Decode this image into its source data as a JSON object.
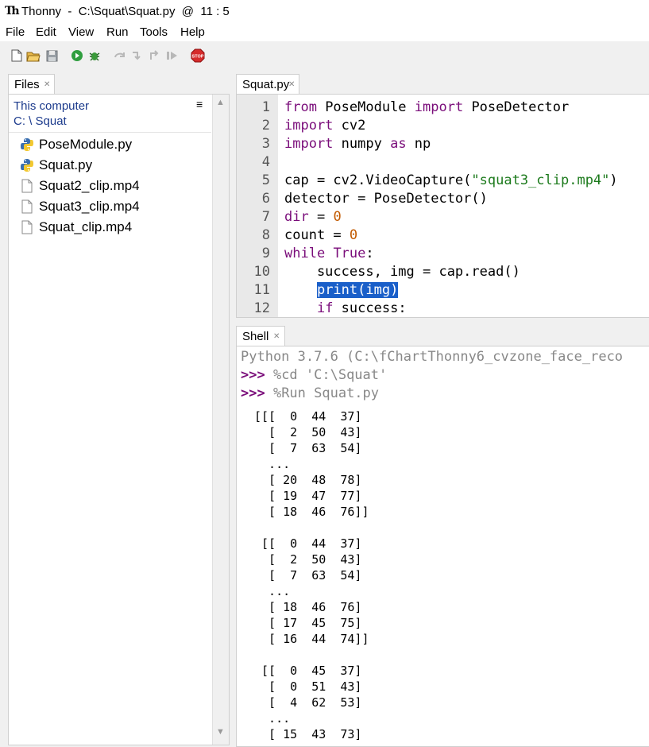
{
  "window": {
    "title": "Thonny  -  C:\\Squat\\Squat.py  @  11 : 5",
    "logo": "Th"
  },
  "menu": [
    "File",
    "Edit",
    "View",
    "Run",
    "Tools",
    "Help"
  ],
  "files_panel": {
    "tab_label": "Files",
    "location_line1": "This computer",
    "location_line2": "C: \\ Squat",
    "files": [
      {
        "name": "PoseModule.py",
        "icon": "python-file-icon"
      },
      {
        "name": "Squat.py",
        "icon": "python-file-icon"
      },
      {
        "name": "Squat2_clip.mp4",
        "icon": "file-icon"
      },
      {
        "name": "Squat3_clip.mp4",
        "icon": "file-icon"
      },
      {
        "name": "Squat_clip.mp4",
        "icon": "file-icon"
      }
    ]
  },
  "editor": {
    "tab_label": "Squat.py",
    "line_numbers": [
      "1",
      "2",
      "3",
      "4",
      "5",
      "6",
      "7",
      "8",
      "9",
      "10",
      "11",
      "12"
    ],
    "lines": {
      "l1": {
        "kw1": "from",
        "mid": " PoseModule ",
        "kw2": "import",
        "end": " PoseDetector"
      },
      "l2": {
        "kw": "import",
        "rest": " cv2"
      },
      "l3": {
        "kw1": "import",
        "mid": " numpy ",
        "kw2": "as",
        "end": " np"
      },
      "l5": {
        "pre": "cap = cv2.VideoCapture(",
        "str": "\"squat3_clip.mp4\"",
        "post": ")"
      },
      "l6": {
        "text": "detector = PoseDetector()"
      },
      "l7": {
        "kw": "dir",
        "mid": " = ",
        "num": "0"
      },
      "l8": {
        "pre": "count = ",
        "num": "0"
      },
      "l9": {
        "kw1": "while",
        "sp": " ",
        "kw2": "True",
        "post": ":"
      },
      "l10": {
        "text": "    success, img = cap.read()"
      },
      "l11": {
        "indent": "    ",
        "sel": "print(img)"
      },
      "l12": {
        "indent": "    ",
        "kw": "if",
        "rest": " success:"
      }
    }
  },
  "shell": {
    "tab_label": "Shell",
    "banner": "Python 3.7.6 (C:\\fChartThonny6_cvzone_face_reco",
    "prompt": ">>>",
    "cmd1": " %cd 'C:\\Squat'",
    "cmd2": " %Run Squat.py",
    "output": [
      "[[[  0  44  37]",
      "  [  2  50  43]",
      "  [  7  63  54]",
      "  ...",
      "  [ 20  48  78]",
      "  [ 19  47  77]",
      "  [ 18  46  76]]",
      "",
      " [[  0  44  37]",
      "  [  2  50  43]",
      "  [  7  63  54]",
      "  ...",
      "  [ 18  46  76]",
      "  [ 17  45  75]",
      "  [ 16  44  74]]",
      "",
      " [[  0  45  37]",
      "  [  0  51  43]",
      "  [  4  62  53]",
      "  ...",
      "  [ 15  43  73]"
    ]
  },
  "colors": {
    "keyword": "#7a0d7a",
    "string": "#1c7a1c",
    "number": "#c25a00",
    "selection": "#1a5fc9",
    "location": "#1b3a8c"
  }
}
